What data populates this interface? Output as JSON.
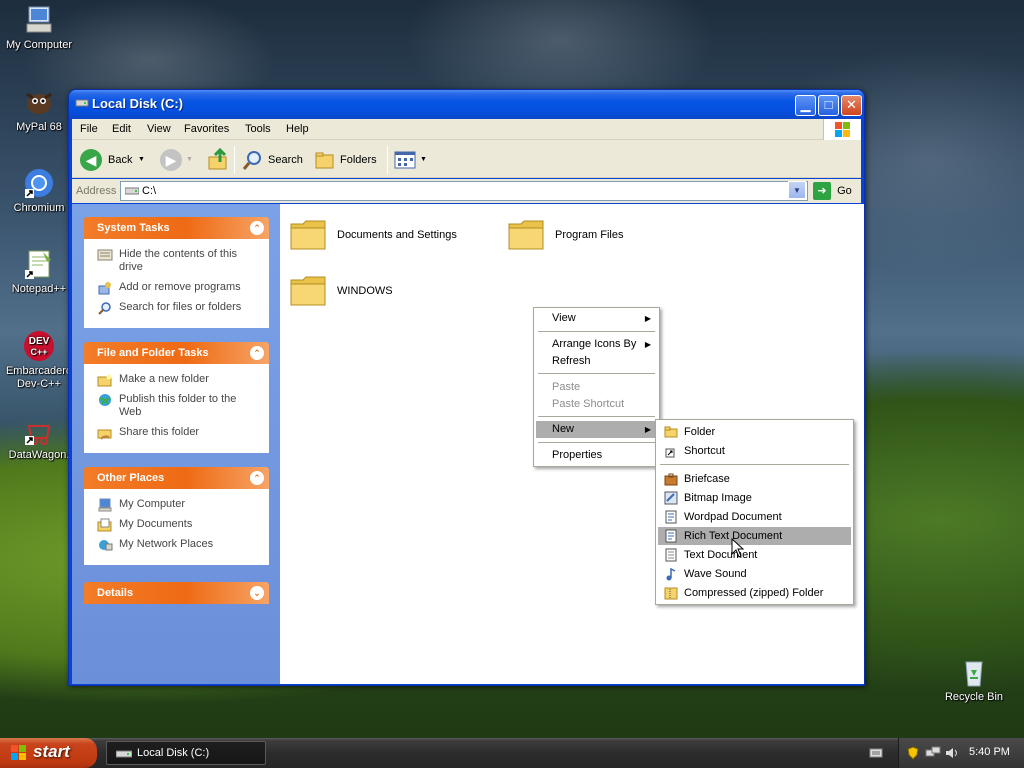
{
  "desktop": {
    "icons": [
      {
        "label": "My Computer"
      },
      {
        "label": "MyPal 68"
      },
      {
        "label": "Chromium"
      },
      {
        "label": "Notepad++"
      },
      {
        "label": "Embarcadero Dev-C++"
      },
      {
        "label": "DataWagon."
      },
      {
        "label": "Recycle Bin"
      }
    ]
  },
  "window": {
    "title": "Local Disk (C:)",
    "menu": [
      "File",
      "Edit",
      "View",
      "Favorites",
      "Tools",
      "Help"
    ],
    "toolbar": {
      "back": "Back",
      "search": "Search",
      "folders": "Folders"
    },
    "address": {
      "label": "Address",
      "value": "C:\\",
      "go": "Go"
    }
  },
  "left_pane": {
    "panels": [
      {
        "title": "System Tasks",
        "links": [
          "Hide the contents of this drive",
          "Add or remove programs",
          "Search for files or folders"
        ]
      },
      {
        "title": "File and Folder Tasks",
        "links": [
          "Make a new folder",
          "Publish this folder to the Web",
          "Share this folder"
        ]
      },
      {
        "title": "Other Places",
        "links": [
          "My Computer",
          "My Documents",
          "My Network Places"
        ]
      },
      {
        "title": "Details",
        "links": []
      }
    ]
  },
  "content": {
    "folders": [
      "Documents and Settings",
      "Program Files",
      "WINDOWS"
    ]
  },
  "context_menu": {
    "items": [
      "View",
      "Arrange Icons By",
      "Refresh",
      "Paste",
      "Paste Shortcut",
      "New",
      "Properties"
    ]
  },
  "new_submenu": {
    "items": [
      "Folder",
      "Shortcut",
      "Briefcase",
      "Bitmap Image",
      "Wordpad Document",
      "Rich Text Document",
      "Text Document",
      "Wave Sound",
      "Compressed (zipped) Folder"
    ],
    "highlighted": "Rich Text Document"
  },
  "taskbar": {
    "start": "start",
    "task": "Local Disk (C:)",
    "clock": "5:40 PM"
  }
}
